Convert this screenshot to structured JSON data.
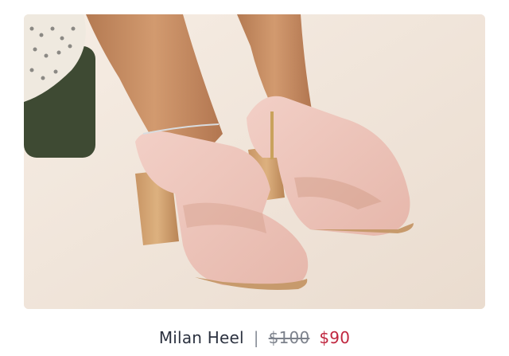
{
  "product": {
    "name": "Milan Heel",
    "separator": "|",
    "original_price": "$100",
    "sale_price": "$90"
  },
  "image": {
    "icon": "product-photo-shoes"
  },
  "colors": {
    "sale": "#c0263f",
    "text": "#2c3240",
    "muted": "#7d828c"
  }
}
